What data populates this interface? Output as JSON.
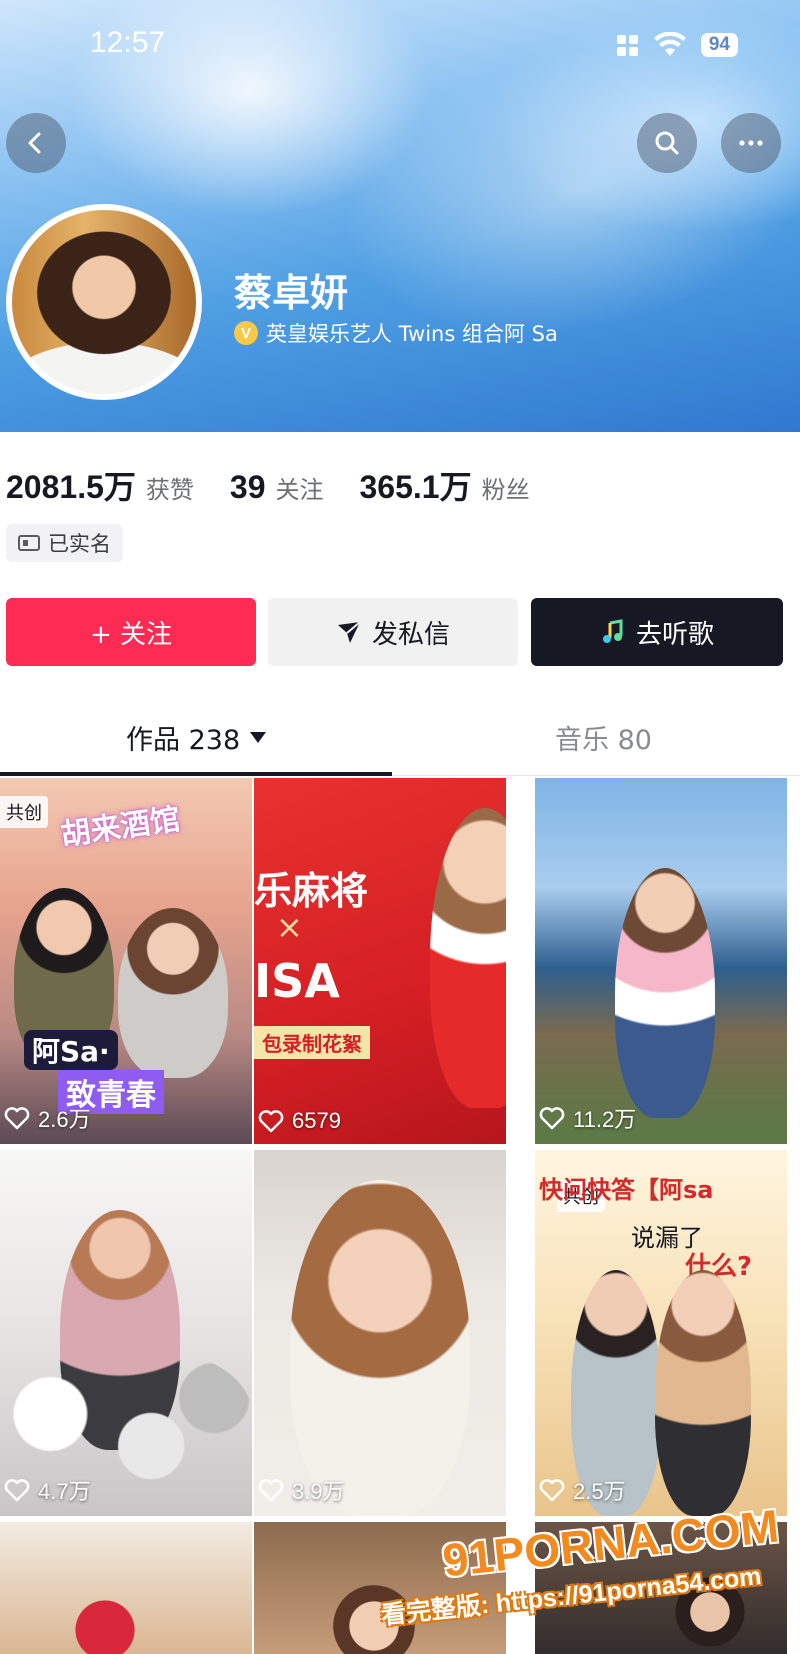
{
  "status_bar": {
    "time": "12:57",
    "battery": "94"
  },
  "profile": {
    "name": "蔡卓妍",
    "verify_badge": "V",
    "verification": "英皇娱乐艺人 Twins 组合阿 Sa",
    "tag": "已实名"
  },
  "stats": [
    {
      "value": "2081.5万",
      "label": "获赞"
    },
    {
      "value": "39",
      "label": "关注"
    },
    {
      "value": "365.1万",
      "label": "粉丝"
    }
  ],
  "actions": {
    "follow": "+ 关注",
    "message": "发私信",
    "music": "去听歌"
  },
  "tabs": {
    "works": "作品 238",
    "music": "音乐 80"
  },
  "tiles": [
    {
      "likes": "2.6万",
      "badge": "共创",
      "text_1": "胡来酒馆",
      "text_2": "阿Sa·",
      "text_3": "致青春"
    },
    {
      "likes": "6579",
      "text_1": "乐麻将",
      "text_2": "×",
      "text_3": "ISA",
      "text_4": "包录制花絮"
    },
    {
      "likes": "11.2万"
    },
    {
      "likes": "4.7万"
    },
    {
      "likes": "3.9万"
    },
    {
      "likes": "2.5万",
      "badge": "共创",
      "text_1": "快问快答【阿sa",
      "text_2": "说漏了",
      "text_3": "什么?"
    },
    {
      "likes": ""
    },
    {
      "likes": ""
    },
    {
      "likes": ""
    }
  ],
  "watermark": {
    "logo": "91PORNA.COM",
    "url": "看完整版: https://91porna54.com"
  }
}
